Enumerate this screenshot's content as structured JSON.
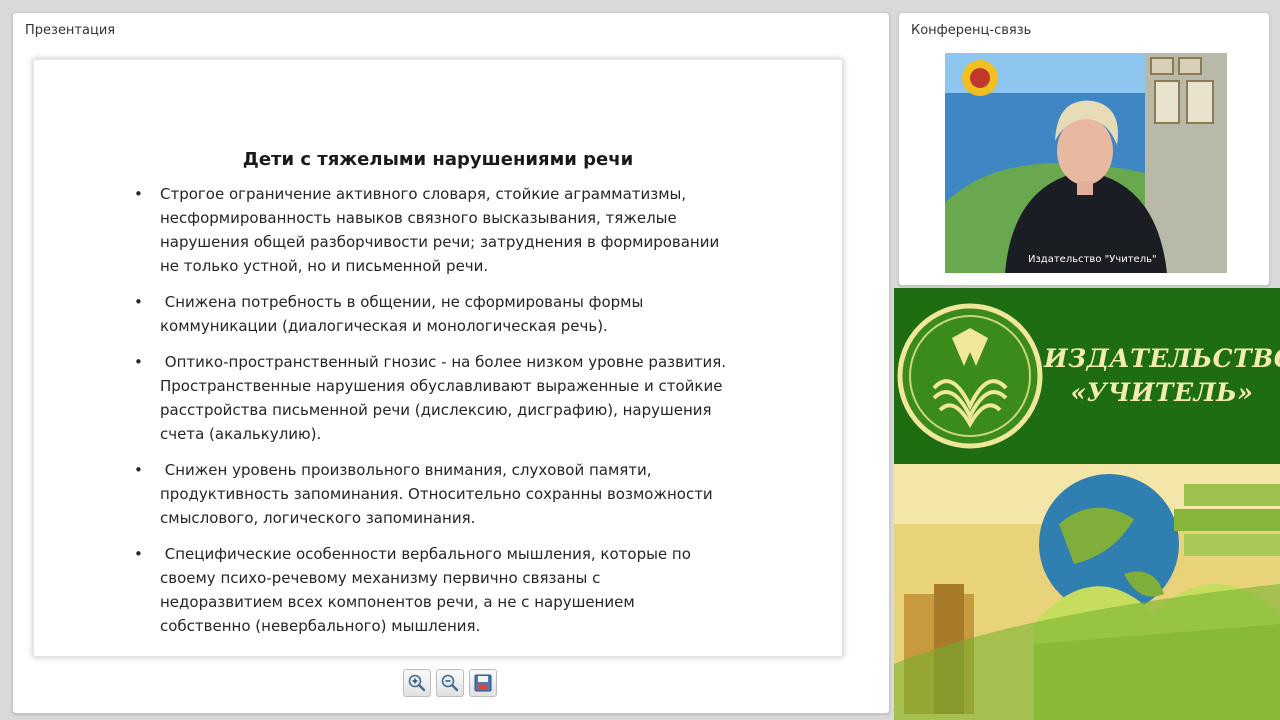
{
  "presentation": {
    "title": "Презентация",
    "slide": {
      "heading": "Дети с тяжелыми нарушениями речи",
      "bullets": [
        {
          "marker": "•",
          "lines": [
            "Строгое ограничение активного словаря, стойкие аграмматизмы,",
            "несформированность навыков связного высказывания, тяжелые",
            "нарушения общей разборчивости речи; затруднения в формировании",
            "не только устной, но и письменной речи."
          ]
        },
        {
          "marker": "•",
          "lines": [
            " Снижена потребность в общении, не сформированы формы",
            "коммуникации (диалогическая и монологическая речь)."
          ]
        },
        {
          "marker": "•",
          "lines": [
            " Оптико-пространственный гнозис - на более низком уровне развития.",
            "Пространственные нарушения обуславливают выраженные и стойкие",
            "расстройства письменной речи (дислексию, дисграфию), нарушения",
            "счета (акалькулию)."
          ]
        },
        {
          "marker": "•",
          "lines": [
            " Снижен уровень произвольного внимания, слуховой памяти,",
            "продуктивность запоминания. Относительно сохранны возможности",
            "смыслового, логического запоминания."
          ]
        },
        {
          "marker": "•",
          "lines": [
            " Специфические особенности вербального мышления, которые по",
            "своему психо-речевому механизму первично связаны с",
            "недоразвитием всех компонентов речи, а не с нарушением",
            "собственно (невербального) мышления."
          ]
        }
      ]
    },
    "toolbar": {
      "zoom_in_icon": "zoom-in-icon",
      "zoom_out_icon": "zoom-out-icon",
      "save_icon": "floppy-disk-icon"
    }
  },
  "conference": {
    "title": "Конференц-связь",
    "video_caption": "Издательство \"Учитель\""
  },
  "banner": {
    "line1": "ИЗДАТЕЛЬСТВО",
    "line2": "«УЧИТЕЛЬ»"
  },
  "colors": {
    "banner_green": "#1f6d13",
    "banner_text": "#f2ecb2",
    "panel_bg": "#ffffff",
    "page_bg": "#d9d9d9"
  }
}
